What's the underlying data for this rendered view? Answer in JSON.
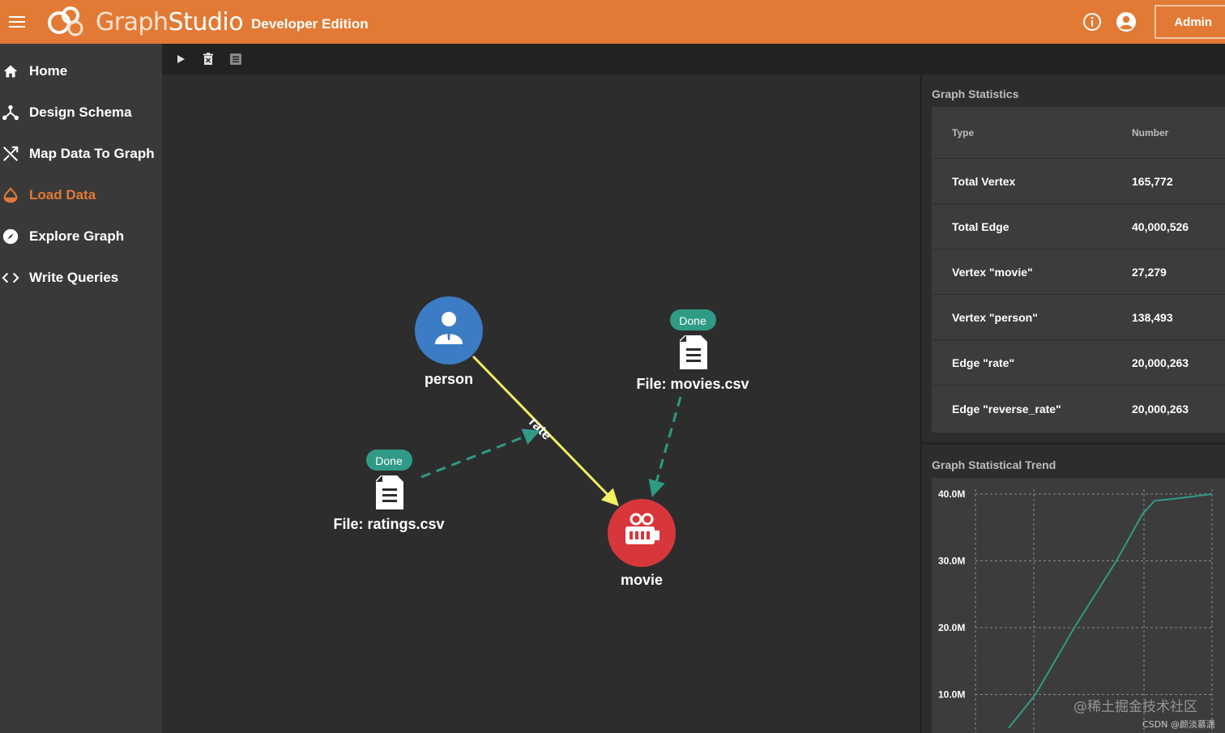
{
  "header": {
    "brand_light": "Graph",
    "brand_bold": "Studio",
    "edition": "Developer Edition",
    "admin_label": "Admin",
    "accent": "#e27a35",
    "icons": [
      "menu-icon",
      "graphstudio-logo",
      "info-icon",
      "account-icon"
    ]
  },
  "sidebar": {
    "active_color": "#e27a35",
    "items": [
      {
        "label": "Home",
        "icon": "home-icon",
        "active": false
      },
      {
        "label": "Design Schema",
        "icon": "schema-icon",
        "active": false
      },
      {
        "label": "Map Data To Graph",
        "icon": "map-icon",
        "active": false
      },
      {
        "label": "Load Data",
        "icon": "load-data-icon",
        "active": true
      },
      {
        "label": "Explore Graph",
        "icon": "compass-icon",
        "active": false
      },
      {
        "label": "Write Queries",
        "icon": "code-icon",
        "active": false
      }
    ]
  },
  "toolbar": {
    "icons": [
      "play-icon",
      "delete-icon",
      "log-icon"
    ]
  },
  "graph": {
    "vertices": [
      {
        "label": "person",
        "icon": "person-icon",
        "color": "#3b7cc4"
      },
      {
        "label": "movie",
        "icon": "movie-camera-icon",
        "color": "#d7373a"
      }
    ],
    "edge_label": "rate",
    "edge_color": "#f2ef62",
    "files": [
      {
        "label": "File: movies.csv",
        "status": "Done"
      },
      {
        "label": "File: ratings.csv",
        "status": "Done"
      }
    ],
    "status_color": "#2f9a86"
  },
  "stats": {
    "title": "Graph Statistics",
    "col_type": "Type",
    "col_number": "Number",
    "rows": [
      {
        "type": "Total Vertex",
        "number": "165,772"
      },
      {
        "type": "Total Edge",
        "number": "40,000,526"
      },
      {
        "type": "Vertex \"movie\"",
        "number": "27,279"
      },
      {
        "type": "Vertex \"person\"",
        "number": "138,493"
      },
      {
        "type": "Edge \"rate\"",
        "number": "20,000,263"
      },
      {
        "type": "Edge \"reverse_rate\"",
        "number": "20,000,263"
      }
    ]
  },
  "trend": {
    "title": "Graph Statistical Trend",
    "line_color": "#2f9a86",
    "y_ticks": [
      "40.0M",
      "30.0M",
      "20.0M",
      "10.0M"
    ],
    "y_tick_values": [
      40,
      30,
      20,
      10
    ],
    "series_millions": [
      5,
      10,
      20,
      30,
      37,
      39,
      39.3,
      40
    ]
  },
  "watermark": {
    "text": "@稀土掘金技术社区",
    "sub": "CSDN @颜淡慕潇"
  }
}
